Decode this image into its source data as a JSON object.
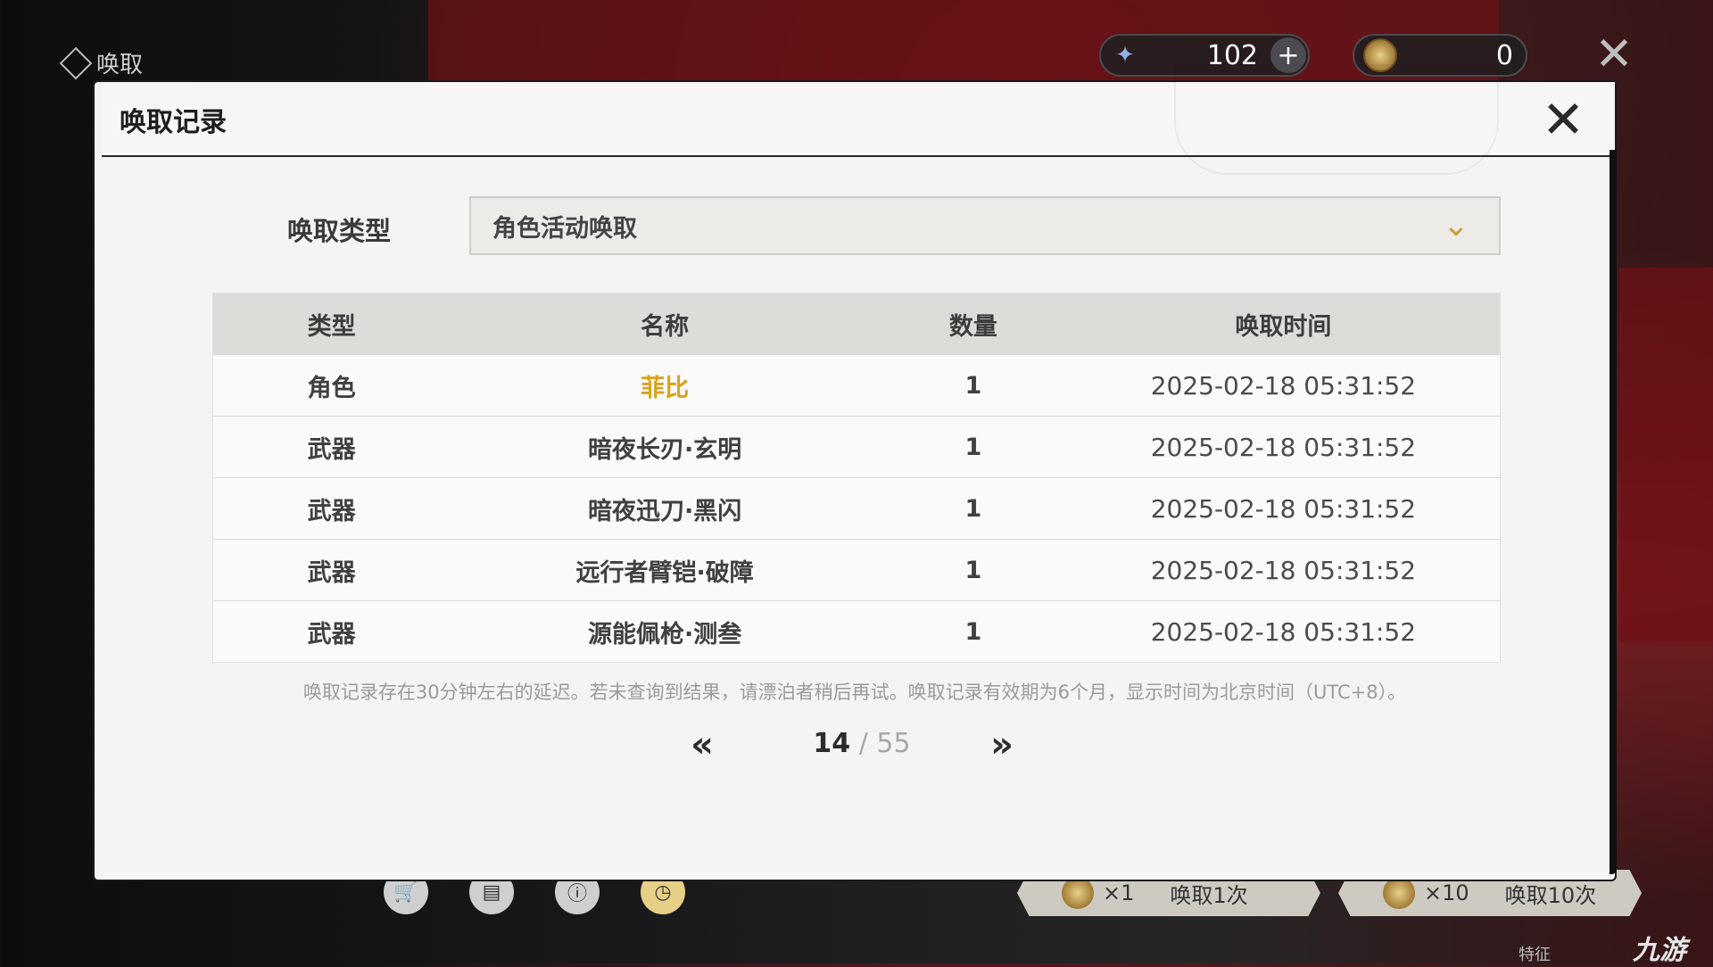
{
  "header": {
    "title": "唤取"
  },
  "currency": {
    "primary": "102",
    "secondary": "0"
  },
  "dialog": {
    "title": "唤取记录",
    "type_label": "唤取类型",
    "type_value": "角色活动唤取",
    "columns": [
      "类型",
      "名称",
      "数量",
      "唤取时间"
    ],
    "rows": [
      {
        "type": "角色",
        "name": "菲比",
        "qty": "1",
        "time": "2025-02-18 05:31:52"
      },
      {
        "type": "武器",
        "name": "暗夜长刃·玄明",
        "qty": "1",
        "time": "2025-02-18 05:31:52"
      },
      {
        "type": "武器",
        "name": "暗夜迅刀·黑闪",
        "qty": "1",
        "time": "2025-02-18 05:31:52"
      },
      {
        "type": "武器",
        "name": "远行者臂铠·破障",
        "qty": "1",
        "time": "2025-02-18 05:31:52"
      },
      {
        "type": "武器",
        "name": "源能佩枪·测叁",
        "qty": "1",
        "time": "2025-02-18 05:31:52"
      }
    ],
    "notice": "唤取记录存在30分钟左右的延迟。若未查询到结果，请漂泊者稍后再试。唤取记录有效期为6个月，显示时间为北京时间（UTC+8）。",
    "pagination": {
      "current": "14",
      "separator": "/",
      "total": "55"
    }
  },
  "bottom": {
    "pull_one": {
      "count": "×1",
      "label": "唤取1次"
    },
    "pull_ten": {
      "count": "×10",
      "label": "唤取10次"
    },
    "feature_text": "特征",
    "watermark": "九游"
  },
  "colors": {
    "highlight_gold": "#d9a21a",
    "accent_chevron": "#c9a046"
  }
}
